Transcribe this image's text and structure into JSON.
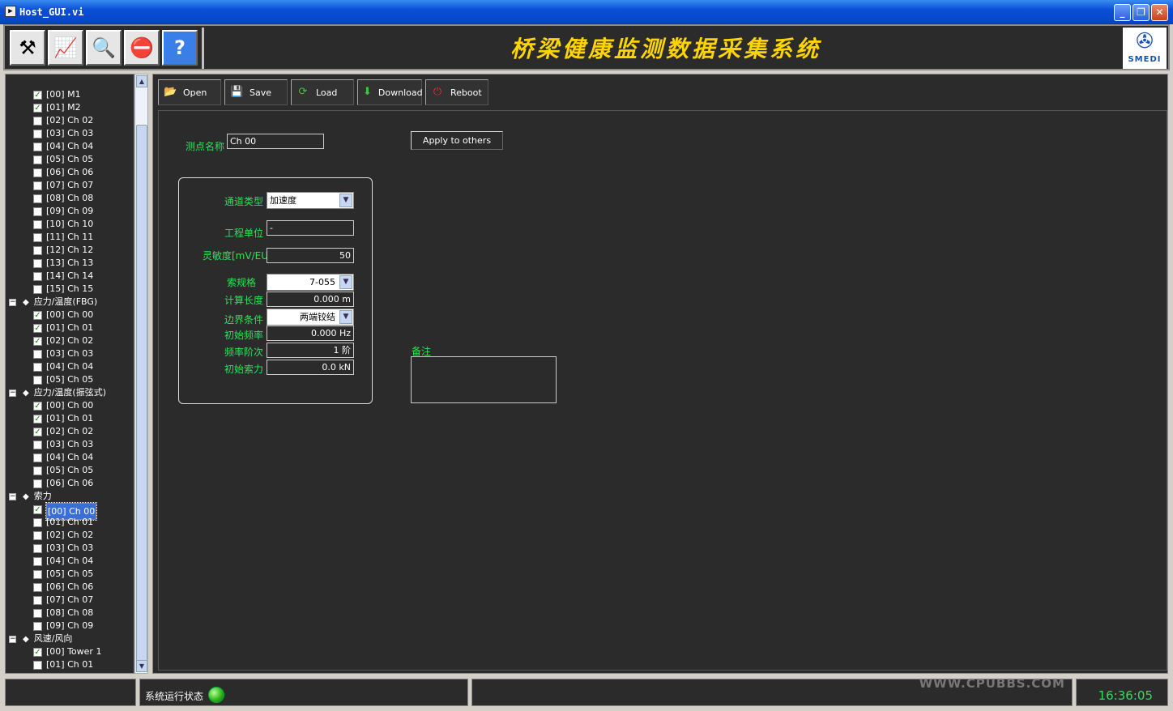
{
  "window": {
    "title": "Host_GUI.vi",
    "min": "_",
    "max": "❐",
    "close": "✕"
  },
  "app_title": "桥梁健康监测数据采集系统",
  "logo_text": "SMEDI",
  "toolbar": [
    {
      "name": "tools-button",
      "icon": "⚒"
    },
    {
      "name": "monitor-button",
      "icon": "📈"
    },
    {
      "name": "search-button",
      "icon": "🔍"
    },
    {
      "name": "stop-button",
      "icon": "⛔"
    },
    {
      "name": "help-button",
      "icon": "?"
    }
  ],
  "actions": [
    {
      "label": "Open",
      "icon": "📂",
      "color": "#f5c518"
    },
    {
      "label": "Save",
      "icon": "💾",
      "color": "#3a7ee8"
    },
    {
      "label": "Load",
      "icon": "⟳",
      "color": "#3cc83c"
    },
    {
      "label": "Download",
      "icon": "⬇",
      "color": "#3cc83c"
    },
    {
      "label": "Reboot",
      "icon": "⏻",
      "color": "#e03030"
    }
  ],
  "tree": [
    {
      "type": "item",
      "label": "[00] M1",
      "checked": true
    },
    {
      "type": "item",
      "label": "[01] M2",
      "checked": true
    },
    {
      "type": "item",
      "label": "[02] Ch 02",
      "checked": false
    },
    {
      "type": "item",
      "label": "[03] Ch 03",
      "checked": false
    },
    {
      "type": "item",
      "label": "[04] Ch 04",
      "checked": false
    },
    {
      "type": "item",
      "label": "[05] Ch 05",
      "checked": false
    },
    {
      "type": "item",
      "label": "[06] Ch 06",
      "checked": false
    },
    {
      "type": "item",
      "label": "[07] Ch 07",
      "checked": false
    },
    {
      "type": "item",
      "label": "[08] Ch 08",
      "checked": false
    },
    {
      "type": "item",
      "label": "[09] Ch 09",
      "checked": false
    },
    {
      "type": "item",
      "label": "[10] Ch 10",
      "checked": false
    },
    {
      "type": "item",
      "label": "[11] Ch 11",
      "checked": false
    },
    {
      "type": "item",
      "label": "[12] Ch 12",
      "checked": false
    },
    {
      "type": "item",
      "label": "[13] Ch 13",
      "checked": false
    },
    {
      "type": "item",
      "label": "[14] Ch 14",
      "checked": false
    },
    {
      "type": "item",
      "label": "[15] Ch 15",
      "checked": false
    },
    {
      "type": "group",
      "label": "应力/温度(FBG)"
    },
    {
      "type": "item",
      "label": "[00] Ch 00",
      "checked": true
    },
    {
      "type": "item",
      "label": "[01] Ch 01",
      "checked": true
    },
    {
      "type": "item",
      "label": "[02] Ch 02",
      "checked": true
    },
    {
      "type": "item",
      "label": "[03] Ch 03",
      "checked": false
    },
    {
      "type": "item",
      "label": "[04] Ch 04",
      "checked": false
    },
    {
      "type": "item",
      "label": "[05] Ch 05",
      "checked": false
    },
    {
      "type": "group",
      "label": "应力/温度(振弦式)"
    },
    {
      "type": "item",
      "label": "[00] Ch 00",
      "checked": true
    },
    {
      "type": "item",
      "label": "[01] Ch 01",
      "checked": true
    },
    {
      "type": "item",
      "label": "[02] Ch 02",
      "checked": true
    },
    {
      "type": "item",
      "label": "[03] Ch 03",
      "checked": false
    },
    {
      "type": "item",
      "label": "[04] Ch 04",
      "checked": false
    },
    {
      "type": "item",
      "label": "[05] Ch 05",
      "checked": false
    },
    {
      "type": "item",
      "label": "[06] Ch 06",
      "checked": false
    },
    {
      "type": "group",
      "label": "索力"
    },
    {
      "type": "item",
      "label": "[00] Ch 00",
      "checked": true,
      "selected": true
    },
    {
      "type": "item",
      "label": "[01] Ch 01",
      "checked": false
    },
    {
      "type": "item",
      "label": "[02] Ch 02",
      "checked": false
    },
    {
      "type": "item",
      "label": "[03] Ch 03",
      "checked": false
    },
    {
      "type": "item",
      "label": "[04] Ch 04",
      "checked": false
    },
    {
      "type": "item",
      "label": "[05] Ch 05",
      "checked": false
    },
    {
      "type": "item",
      "label": "[06] Ch 06",
      "checked": false
    },
    {
      "type": "item",
      "label": "[07] Ch 07",
      "checked": false
    },
    {
      "type": "item",
      "label": "[08] Ch 08",
      "checked": false
    },
    {
      "type": "item",
      "label": "[09] Ch 09",
      "checked": false
    },
    {
      "type": "group",
      "label": "风速/风向"
    },
    {
      "type": "item",
      "label": "[00] Tower 1",
      "checked": true
    },
    {
      "type": "item",
      "label": "[01] Ch 01",
      "checked": false
    }
  ],
  "form": {
    "point_name_label": "测点名称",
    "point_name": "Ch 00",
    "apply_label": "Apply to others",
    "channel_type_label": "通道类型",
    "channel_type": "加速度",
    "unit_label": "工程单位",
    "unit": "-",
    "sensitivity_label": "灵敏度[mV/EU]",
    "sensitivity": "50",
    "cable_spec_label": "索规格",
    "cable_spec": "7-055",
    "calc_length_label": "计算长度",
    "calc_length": "0.000 m",
    "boundary_label": "边界条件",
    "boundary": "两端铰结",
    "init_freq_label": "初始频率",
    "init_freq": "0.000 Hz",
    "freq_order_label": "频率阶次",
    "freq_order": "1 阶",
    "init_force_label": "初始索力",
    "init_force": "0.0 kN",
    "note_label": "备注"
  },
  "status": {
    "label": "系统运行状态",
    "time": "16:36:05",
    "watermark": "WWW.CPUBBS.COM"
  }
}
